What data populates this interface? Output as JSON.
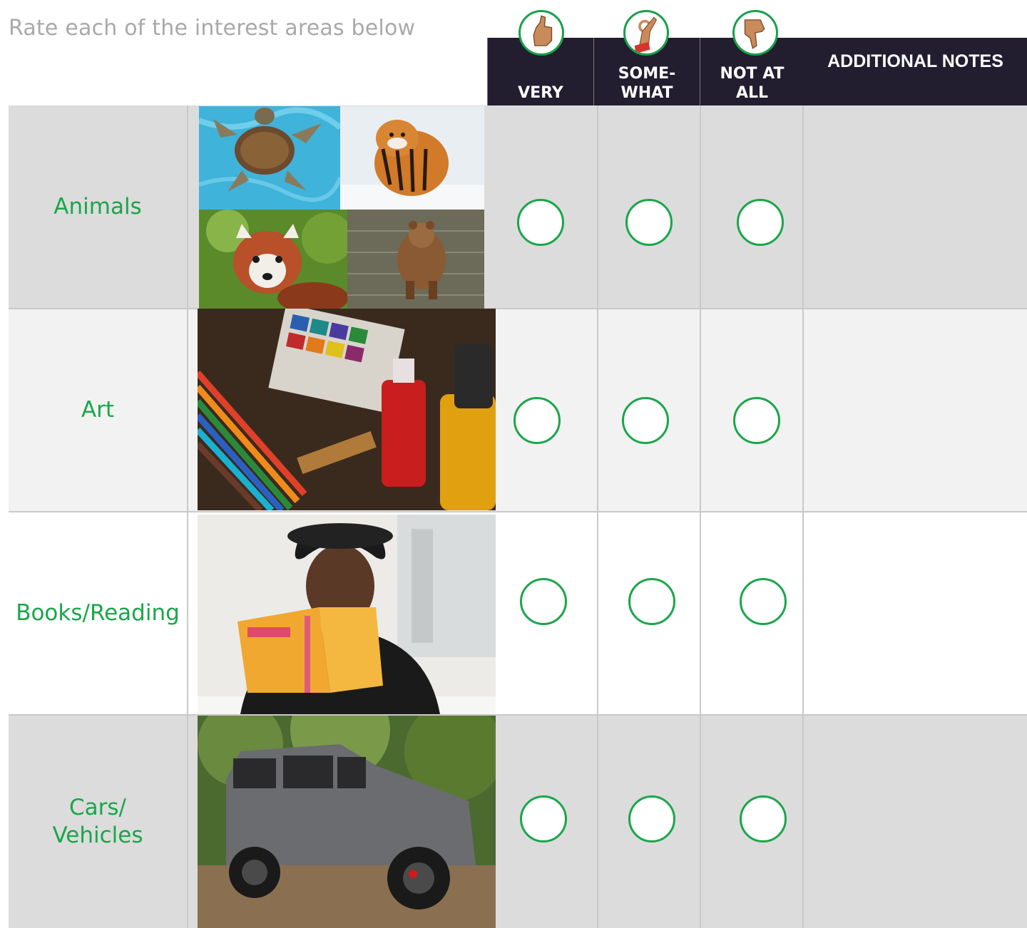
{
  "instruction": "Rate each of the interest areas below",
  "header": {
    "columns": [
      {
        "label": "VERY",
        "icon": "thumbs-up-icon"
      },
      {
        "label": "SOME-\nWHAT",
        "icon": "ok-hand-icon"
      },
      {
        "label": "NOT AT\nALL",
        "icon": "thumbs-down-icon"
      }
    ],
    "notes_label": "ADDITIONAL NOTES"
  },
  "rows": [
    {
      "label": "Animals",
      "images": [
        "sea-turtle",
        "tiger",
        "red-panda",
        "bear"
      ]
    },
    {
      "label": "Art",
      "images": [
        "art-supplies"
      ]
    },
    {
      "label": "Books/Reading",
      "images": [
        "woman-reading-book"
      ]
    },
    {
      "label": "Cars/\nVehicles",
      "images": [
        "grey-suv"
      ]
    }
  ],
  "colors": {
    "accent_green": "#1aa64a",
    "header_bg": "#221d2f",
    "row_shade": "#dcdcdc",
    "row_light": "#f2f2f2"
  }
}
